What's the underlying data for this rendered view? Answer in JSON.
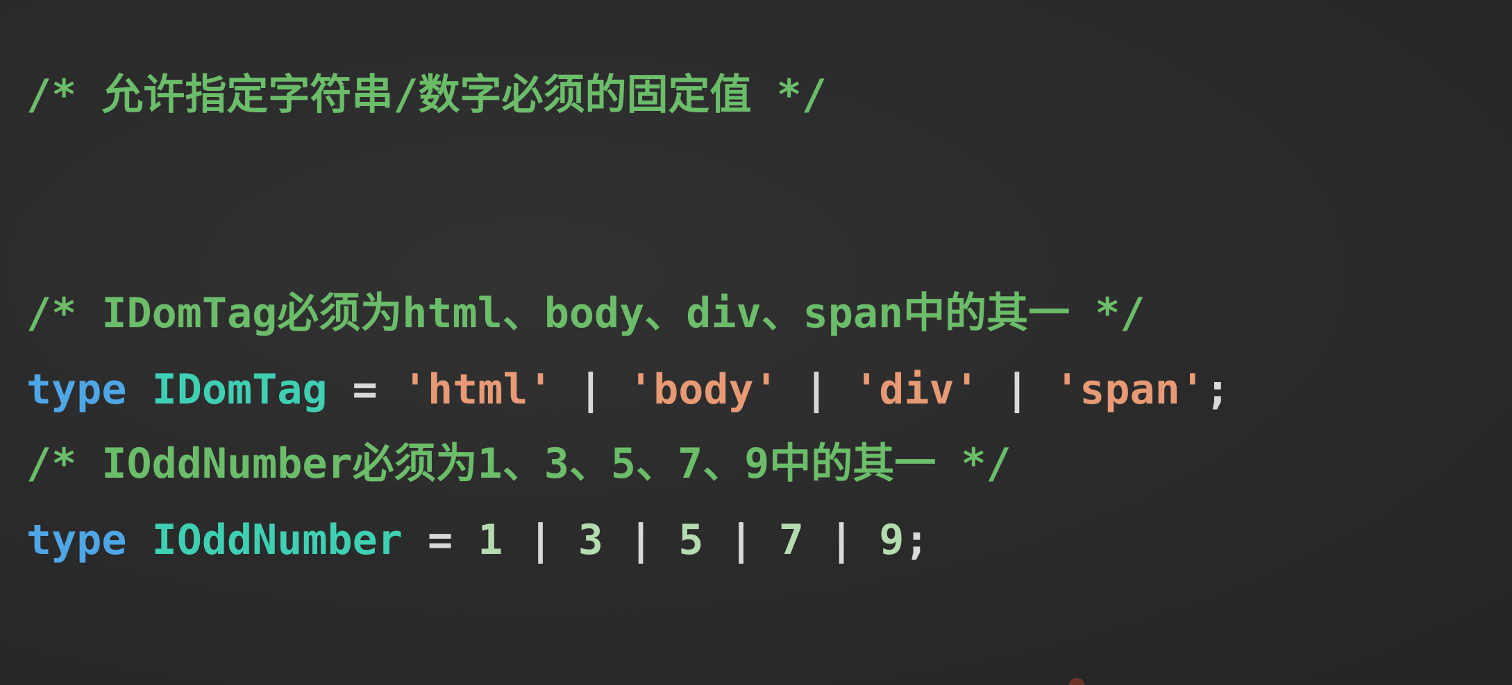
{
  "colors": {
    "background": "#2b2b2b",
    "comment": "#6bbd6a",
    "keyword": "#4ea6e6",
    "type_name": "#3fd0b3",
    "operator": "#d9d9d9",
    "string": "#e79a75",
    "number": "#b5dcb0"
  },
  "code": {
    "line1": {
      "comment": "/* 允许指定字符串/数字必须的固定值 */"
    },
    "line2": {
      "comment": "/* IDomTag必须为html、body、div、span中的其一 */"
    },
    "line3": {
      "keyword": "type",
      "name": "IDomTag",
      "eq": "=",
      "s1": "'html'",
      "s2": "'body'",
      "s3": "'div'",
      "s4": "'span'",
      "pipe": "|",
      "end": ";"
    },
    "line4": {
      "comment": "/* IOddNumber必须为1、3、5、7、9中的其一 */"
    },
    "line5": {
      "keyword": "type",
      "name": "IOddNumber",
      "eq": "=",
      "n1": "1",
      "n2": "3",
      "n3": "5",
      "n4": "7",
      "n5": "9",
      "pipe": "|",
      "end": ";"
    }
  }
}
